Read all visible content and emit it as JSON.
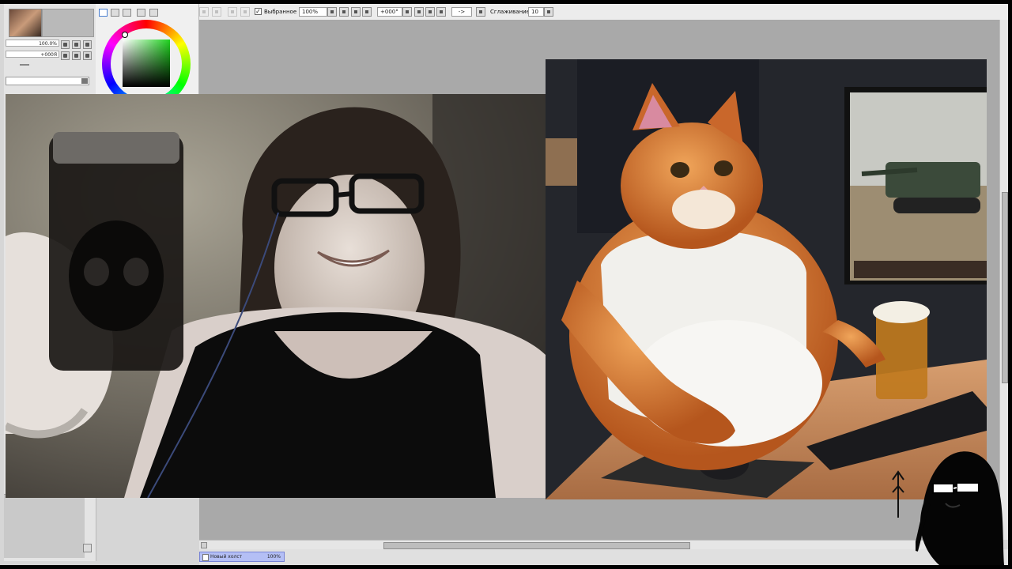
{
  "window": {
    "title": ""
  },
  "navigator": {
    "zoom_value": "100.0%",
    "angle_value": "+000Я"
  },
  "color_panel": {
    "tabs": [
      "color-wheel-icon",
      "rgb-slider-icon",
      "hsv-slider-icon",
      "palette-icon",
      "swatch-icon"
    ],
    "selected_color": "#1fd21f"
  },
  "toolbar": {
    "selection_checkbox_label": "Выбранное",
    "selection_checked": true,
    "zoom_value": "100%",
    "rotation_value": "+000°",
    "flip_value": "->",
    "smoothing_label": "Сглаживание",
    "smoothing_value": "10"
  },
  "status": {
    "document_name": "Новый холст",
    "document_zoom": "100%"
  },
  "canvas": {
    "background": "#a9a9a9",
    "images": [
      "webcam-photo",
      "cat-gamer-illustration"
    ]
  }
}
